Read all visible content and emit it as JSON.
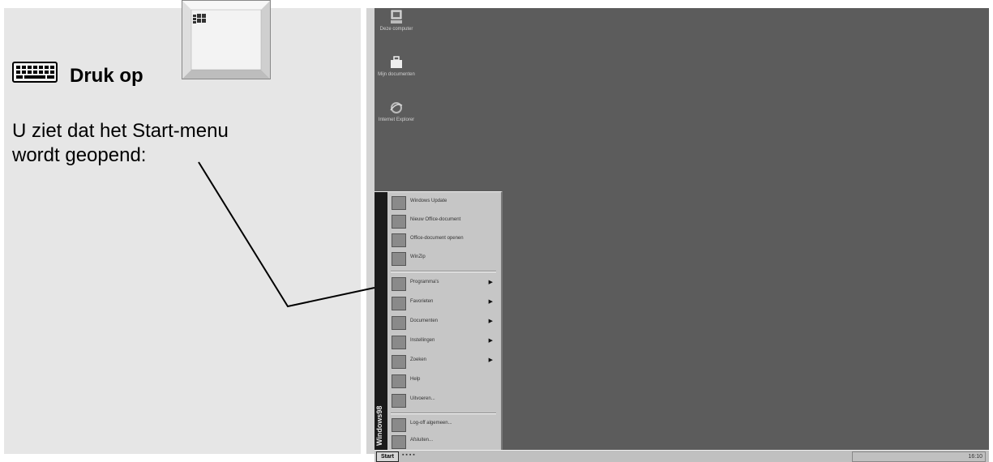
{
  "instruction": {
    "druk_label": "Druk op",
    "body_line1": "U ziet dat het Start-menu",
    "body_line2": "wordt geopend:"
  },
  "desktop": {
    "icons": [
      {
        "label": "Deze computer",
        "icon": "computer-icon"
      },
      {
        "label": "Mijn documenten",
        "icon": "briefcase-icon"
      },
      {
        "label": "Internet Explorer",
        "icon": "internet-explorer-icon"
      }
    ]
  },
  "start_menu": {
    "side_text": "Windows98",
    "top_items": [
      {
        "label": "Windows Update",
        "icon": "windows-update-icon"
      },
      {
        "label": "Nieuw Office-document",
        "icon": "new-office-document-icon"
      },
      {
        "label": "Office-document openen",
        "icon": "open-office-document-icon"
      },
      {
        "label": "WinZip",
        "icon": "winzip-icon"
      }
    ],
    "items": [
      {
        "label": "Programma's",
        "icon": "programs-icon",
        "submenu": true
      },
      {
        "label": "Favorieten",
        "icon": "favorites-icon",
        "submenu": true
      },
      {
        "label": "Documenten",
        "icon": "documents-icon",
        "submenu": true
      },
      {
        "label": "Instellingen",
        "icon": "settings-icon",
        "submenu": true
      },
      {
        "label": "Zoeken",
        "icon": "search-icon",
        "submenu": true
      },
      {
        "label": "Help",
        "icon": "help-icon",
        "submenu": false
      },
      {
        "label": "Uitvoeren...",
        "icon": "run-icon",
        "submenu": false
      },
      {
        "label": "Log-off algemeen...",
        "icon": "logoff-icon",
        "submenu": false
      },
      {
        "label": "Afsluiten...",
        "icon": "shutdown-icon",
        "submenu": false
      }
    ]
  },
  "taskbar": {
    "start_label": "Start",
    "tray_text": "16:10"
  }
}
